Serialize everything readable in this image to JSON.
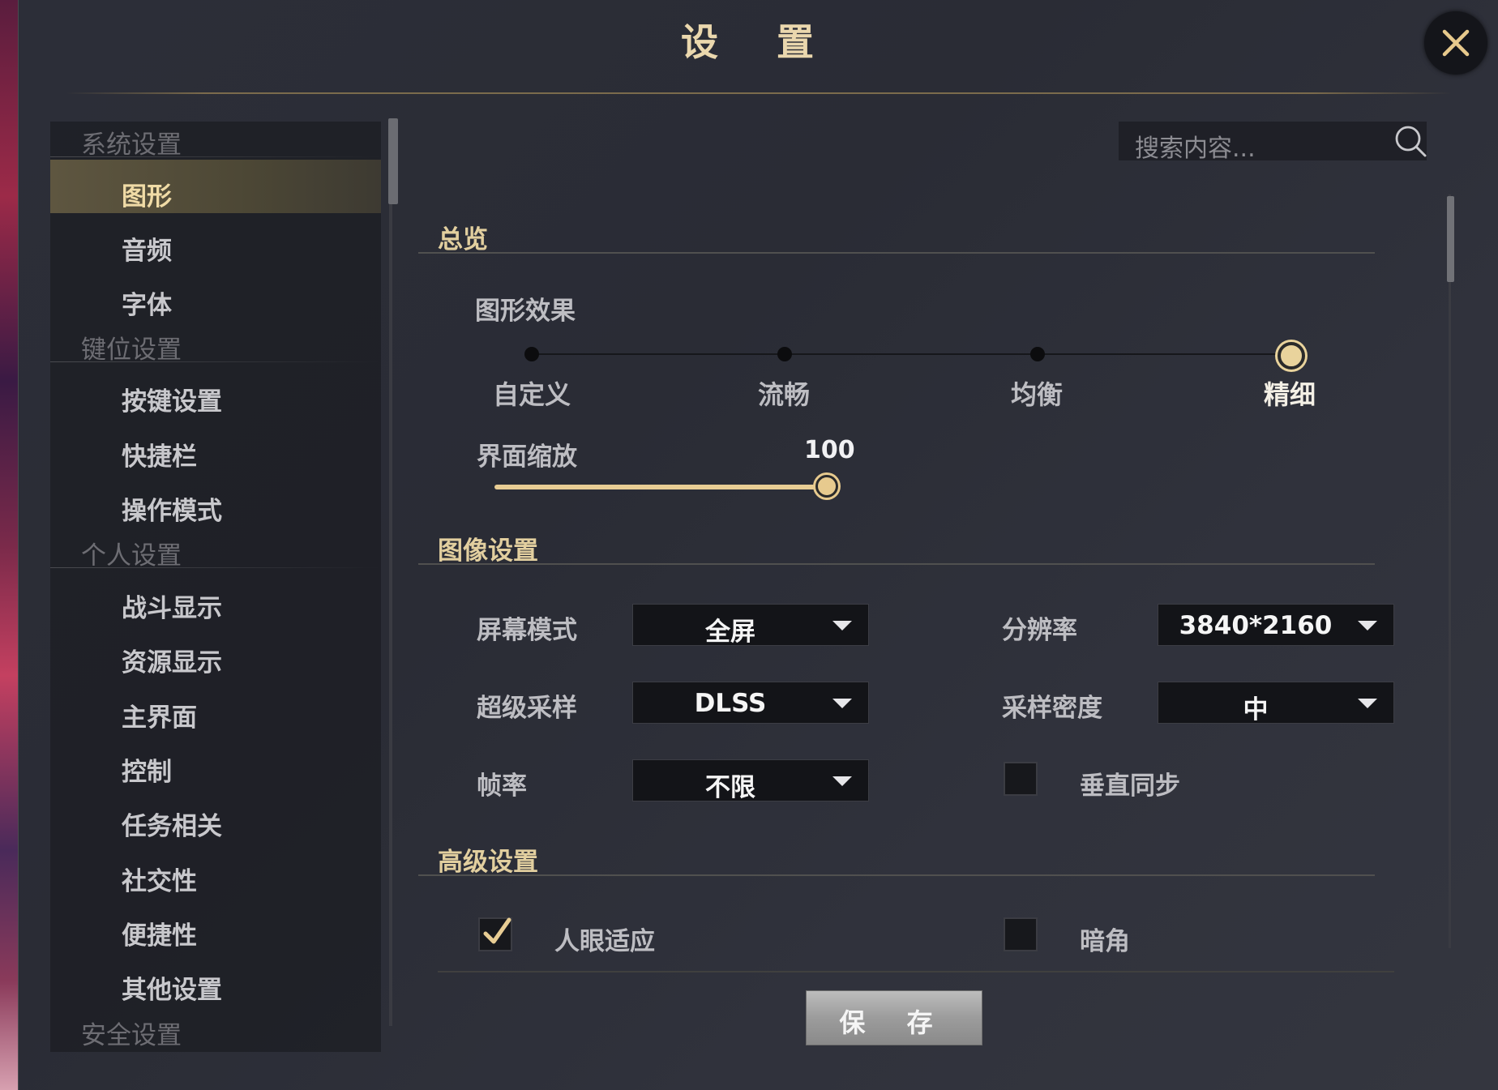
{
  "window": {
    "title": "设  置"
  },
  "sidebar": {
    "categories": [
      "系统设置",
      "键位设置",
      "个人设置",
      "安全设置"
    ],
    "items": [
      "图形",
      "音频",
      "字体",
      "按键设置",
      "快捷栏",
      "操作模式",
      "战斗显示",
      "资源显示",
      "主界面",
      "控制",
      "任务相关",
      "社交性",
      "便捷性",
      "其他设置"
    ],
    "active_item": "图形"
  },
  "search": {
    "placeholder": "搜索内容..."
  },
  "overview": {
    "title": "总览",
    "graphics_effect_label": "图形效果",
    "quality_presets": [
      "自定义",
      "流畅",
      "均衡",
      "精细"
    ],
    "selected_preset": "精细",
    "ui_scale_label": "界面缩放",
    "ui_scale_value": "100",
    "ui_scale_fraction": 1.0
  },
  "image_settings": {
    "title": "图像设置",
    "screen_mode_label": "屏幕模式",
    "screen_mode_value": "全屏",
    "resolution_label": "分辨率",
    "resolution_value": "3840*2160",
    "supersampling_label": "超级采样",
    "supersampling_value": "DLSS",
    "sampling_density_label": "采样密度",
    "sampling_density_value": "中",
    "framerate_label": "帧率",
    "framerate_value": "不限",
    "vsync_label": "垂直同步",
    "vsync_checked": false
  },
  "advanced_settings": {
    "title": "高级设置",
    "eye_adaptation_label": "人眼适应",
    "eye_adaptation_checked": true,
    "vignette_label": "暗角",
    "vignette_checked": false
  },
  "footer": {
    "save_label": "保  存"
  },
  "colors": {
    "accent": "#e8cd94",
    "title": "#ead7ad",
    "panel": "#2c2e38"
  }
}
